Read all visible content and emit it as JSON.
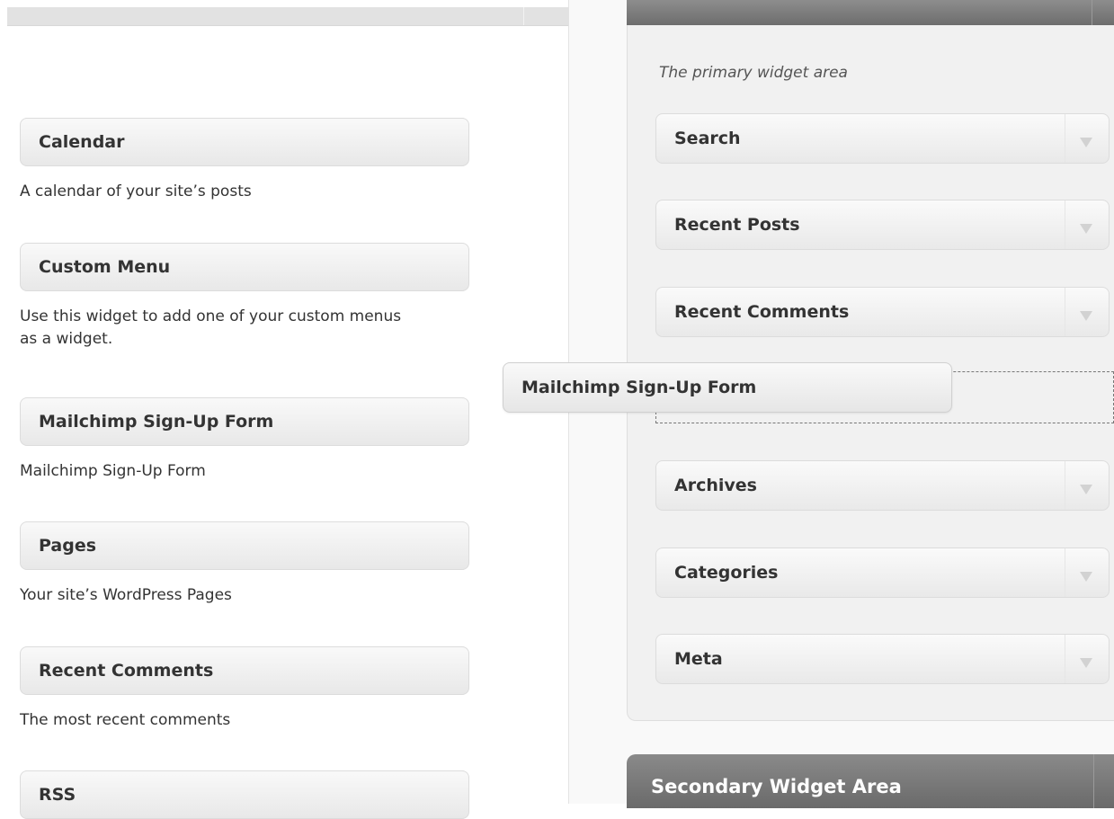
{
  "available_widgets": [
    {
      "title": "Calendar",
      "description": "A calendar of your site’s posts"
    },
    {
      "title": "Custom Menu",
      "description": "Use this widget to add one of your custom menus as a widget."
    },
    {
      "title": "Mailchimp Sign-Up Form",
      "description": "Mailchimp Sign-Up Form"
    },
    {
      "title": "Pages",
      "description": "Your site’s WordPress Pages"
    },
    {
      "title": "Recent Comments",
      "description": "The most recent comments"
    },
    {
      "title": "RSS",
      "description": ""
    }
  ],
  "primary_area": {
    "description": "The primary widget area",
    "widgets": [
      "Search",
      "Recent Posts",
      "Recent Comments",
      "Archives",
      "Categories",
      "Meta"
    ]
  },
  "dragging_widget": "Mailchimp Sign-Up Form",
  "secondary_area": {
    "title": "Secondary Widget Area"
  },
  "icons": {
    "widget_toggle": "triangle-down-icon"
  },
  "colors": {
    "header_gray": "#767676",
    "panel_bg": "#f1f1f1"
  }
}
